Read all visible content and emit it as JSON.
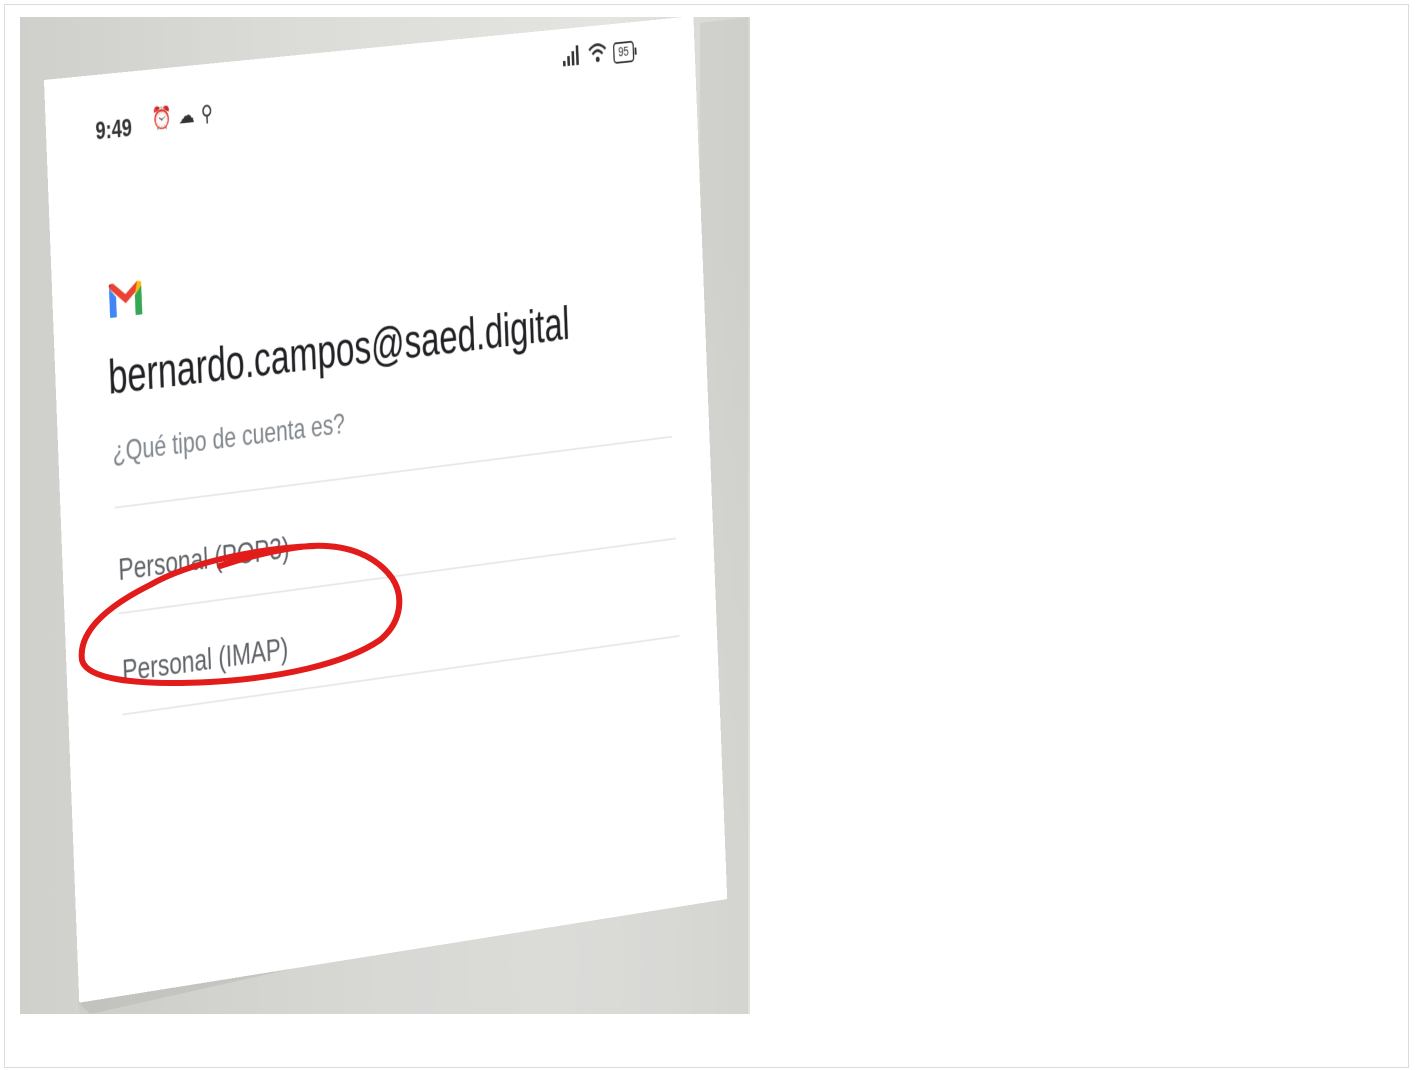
{
  "status_bar": {
    "time": "9:49",
    "left_icons": [
      "alarm-icon",
      "cloud-icon",
      "location-icon"
    ],
    "right_icons": [
      "signal-icon",
      "wifi-icon",
      "battery-icon"
    ],
    "battery_level": "95"
  },
  "app": {
    "logo": "gmail-logo",
    "logo_colors": [
      "#4285F4",
      "#EA4335",
      "#FBBC04",
      "#34A853",
      "#C5221F"
    ]
  },
  "account": {
    "email": "bernardo.campos@saed.digital",
    "question": "¿Qué tipo de cuenta es?"
  },
  "options": [
    {
      "label": "Personal (POP3)"
    },
    {
      "label": "Personal (IMAP)",
      "highlighted": true
    }
  ],
  "annotation": {
    "color": "#e21b1b",
    "target": "Personal (IMAP)"
  }
}
